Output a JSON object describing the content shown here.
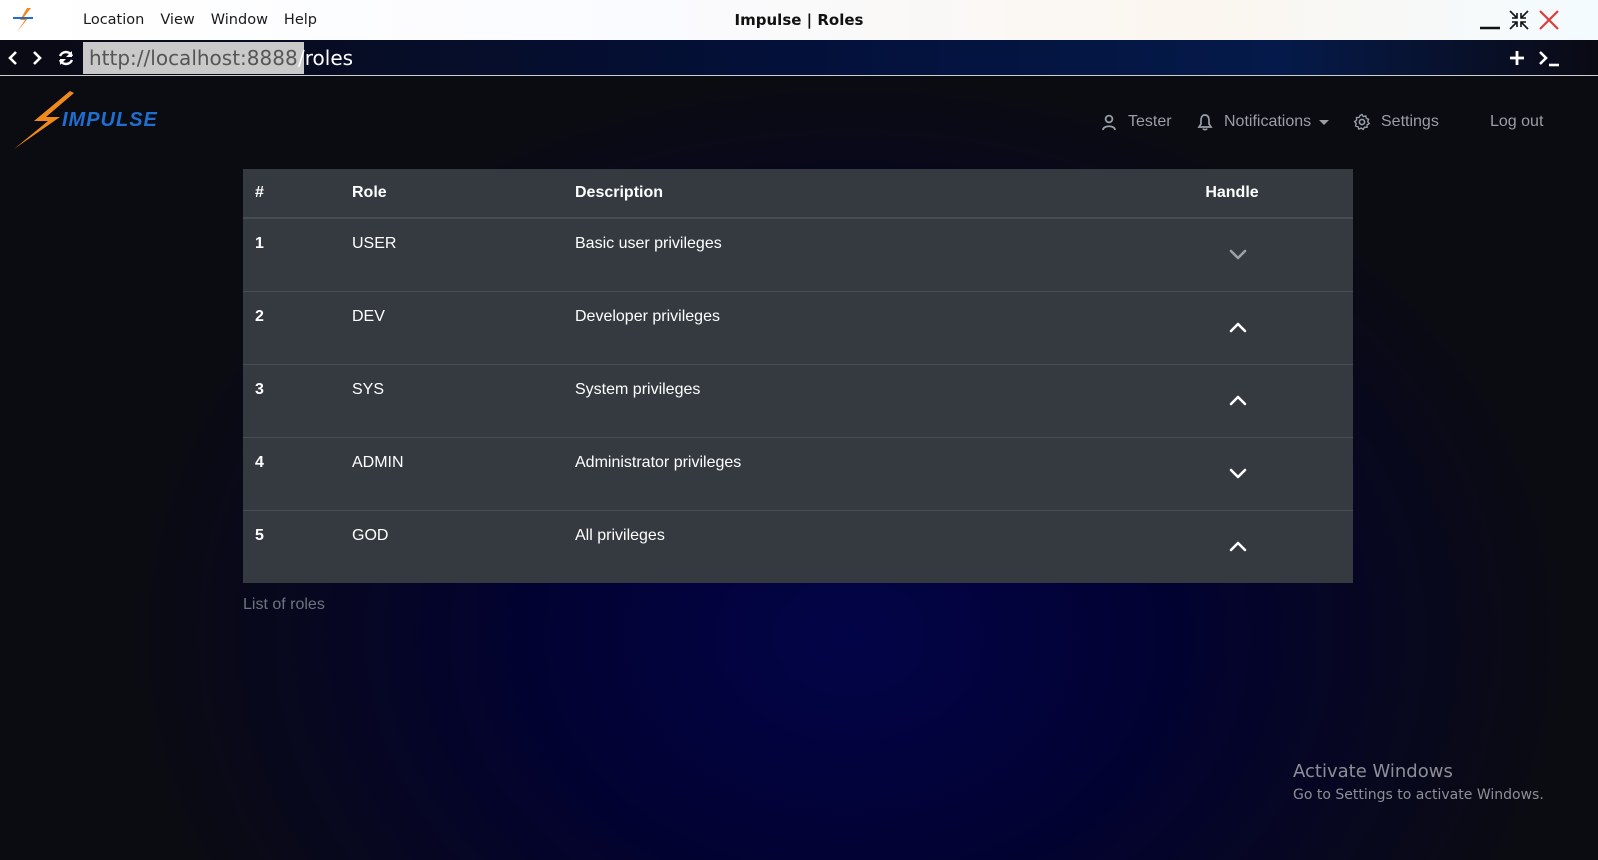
{
  "window": {
    "title": "Impulse | Roles",
    "menu": [
      "Location",
      "View",
      "Window",
      "Help"
    ]
  },
  "address": {
    "host": "http://localhost:8888",
    "path": "/roles"
  },
  "nav": {
    "user": "Tester",
    "notifications": "Notifications",
    "settings": "Settings",
    "logout": "Log out"
  },
  "brand": {
    "name": "IMPULSE",
    "accent": "#f08a1c",
    "text_color": "#1e6fd0"
  },
  "table": {
    "headers": [
      "#",
      "Role",
      "Description",
      "Handle"
    ],
    "rows": [
      {
        "num": "1",
        "role": "USER",
        "description": "Basic user privileges",
        "handle": "chevron-down",
        "handle_color": "#9aa0a6"
      },
      {
        "num": "2",
        "role": "DEV",
        "description": "Developer privileges",
        "handle": "chevron-up",
        "handle_color": "#ffffff"
      },
      {
        "num": "3",
        "role": "SYS",
        "description": "System privileges",
        "handle": "chevron-up",
        "handle_color": "#ffffff"
      },
      {
        "num": "4",
        "role": "ADMIN",
        "description": "Administrator privileges",
        "handle": "chevron-down",
        "handle_color": "#ffffff"
      },
      {
        "num": "5",
        "role": "GOD",
        "description": "All privileges",
        "handle": "chevron-up",
        "handle_color": "#ffffff"
      }
    ],
    "caption": "List of roles"
  },
  "watermark": {
    "line1": "Activate Windows",
    "line2": "Go to Settings to activate Windows."
  }
}
